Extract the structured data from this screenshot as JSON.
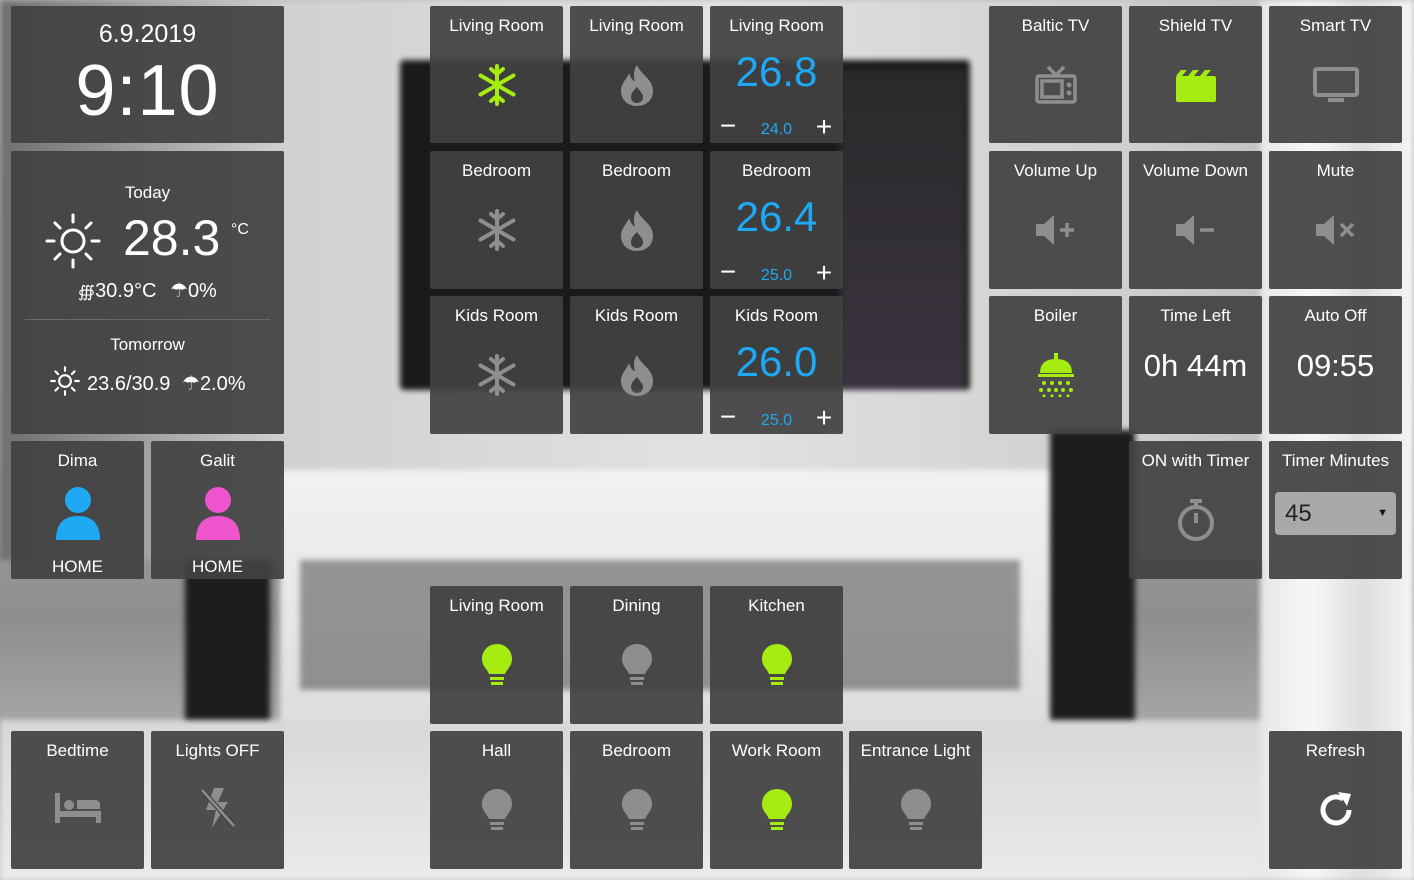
{
  "clock": {
    "date": "6.9.2019",
    "time": "9:10"
  },
  "weather": {
    "today_label": "Today",
    "today_temp": "28.3",
    "unit": "°C",
    "today_feels": "30.9°C",
    "today_rain": "0%",
    "tomorrow_label": "Tomorrow",
    "tomorrow_temp": "23.6/30.9",
    "tomorrow_rain": "2.0%",
    "icon": "sun-icon"
  },
  "people": [
    {
      "name": "Dima",
      "state": "HOME",
      "color": "#1fa9f5"
    },
    {
      "name": "Galit",
      "state": "HOME",
      "color": "#ee55cc"
    }
  ],
  "scenes": {
    "bedtime": "Bedtime",
    "lights_off": "Lights OFF"
  },
  "climate": {
    "living": {
      "cool": "Living Room",
      "heat": "Living Room",
      "thermo": "Living Room",
      "temp": "26.8",
      "set": "24.0",
      "cool_on": true
    },
    "bedroom": {
      "cool": "Bedroom",
      "heat": "Bedroom",
      "thermo": "Bedroom",
      "temp": "26.4",
      "set": "25.0",
      "cool_on": false
    },
    "kids": {
      "cool": "Kids Room",
      "heat": "Kids Room",
      "thermo": "Kids Room",
      "temp": "26.0",
      "set": "25.0",
      "cool_on": false
    }
  },
  "lights": {
    "living": {
      "label": "Living Room",
      "on": true
    },
    "dining": {
      "label": "Dining",
      "on": false
    },
    "kitchen": {
      "label": "Kitchen",
      "on": true
    },
    "hall": {
      "label": "Hall",
      "on": false
    },
    "bedroom": {
      "label": "Bedroom",
      "on": false
    },
    "work": {
      "label": "Work Room",
      "on": true
    },
    "entrance": {
      "label": "Entrance Light",
      "on": false
    }
  },
  "media": {
    "baltic": "Baltic TV",
    "shield": "Shield TV",
    "smart": "Smart TV",
    "vol_up": "Volume Up",
    "vol_down": "Volume Down",
    "mute": "Mute"
  },
  "boiler": {
    "label": "Boiler",
    "time_left_label": "Time Left",
    "time_left": "0h 44m",
    "auto_off_label": "Auto Off",
    "auto_off": "09:55",
    "on_timer_label": "ON with Timer",
    "timer_minutes_label": "Timer Minutes",
    "timer_minutes": "45"
  },
  "refresh": "Refresh",
  "colors": {
    "accent_on": "#a6ec11",
    "off": "#8e8e8e",
    "thermo_blue": "#1fa9f5",
    "tile_bg": "#424242"
  }
}
